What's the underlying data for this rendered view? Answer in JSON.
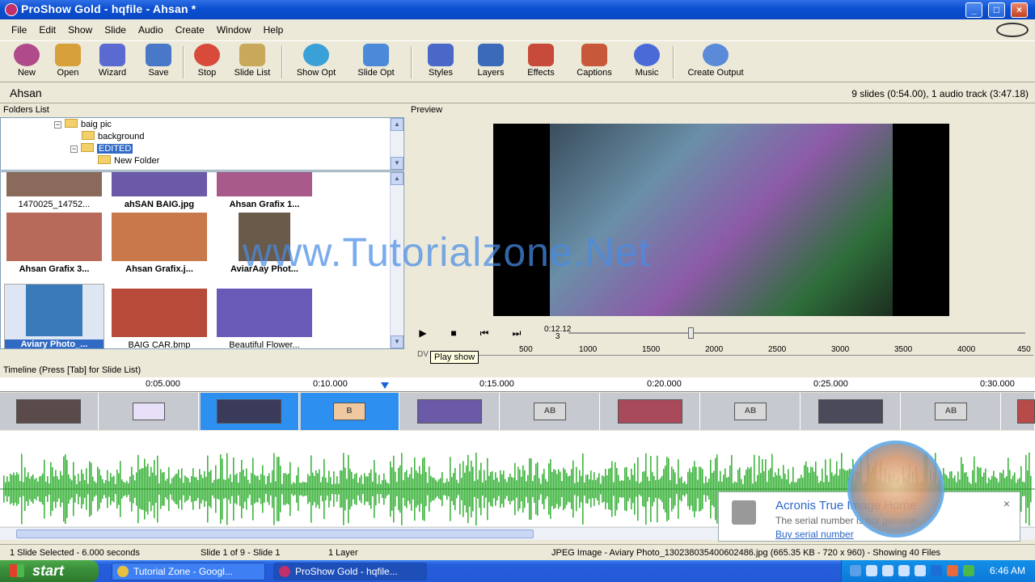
{
  "window": {
    "title": "ProShow Gold - hqfile - Ahsan *"
  },
  "menu": [
    "File",
    "Edit",
    "Show",
    "Slide",
    "Audio",
    "Create",
    "Window",
    "Help"
  ],
  "toolbar": [
    {
      "label": "New",
      "icon": "new-icon",
      "color": "#b04a8a"
    },
    {
      "label": "Open",
      "icon": "open-icon",
      "color": "#d8a03a"
    },
    {
      "label": "Wizard",
      "icon": "wizard-icon",
      "color": "#5a6ad0"
    },
    {
      "label": "Save",
      "icon": "save-icon",
      "color": "#4a78c8"
    },
    {
      "label": "Stop",
      "icon": "stop-icon",
      "color": "#d84a3a"
    },
    {
      "label": "Slide List",
      "icon": "slide-list-icon",
      "color": "#c8a85a"
    },
    {
      "label": "Show Opt",
      "icon": "show-options-icon",
      "color": "#3aa0d8"
    },
    {
      "label": "Slide Opt",
      "icon": "slide-options-icon",
      "color": "#4a8ad8"
    },
    {
      "label": "Styles",
      "icon": "styles-icon",
      "color": "#4a68c8"
    },
    {
      "label": "Layers",
      "icon": "layers-icon",
      "color": "#3a6ab8"
    },
    {
      "label": "Effects",
      "icon": "effects-icon",
      "color": "#c84a3a"
    },
    {
      "label": "Captions",
      "icon": "captions-icon",
      "color": "#c8583a"
    },
    {
      "label": "Music",
      "icon": "music-icon",
      "color": "#4a6ad8"
    },
    {
      "label": "Create Output",
      "icon": "create-output-icon",
      "color": "#5a8ad8"
    }
  ],
  "show": {
    "name": "Ahsan",
    "info": "9 slides (0:54.00), 1 audio track (3:47.18)"
  },
  "folders": {
    "header": "Folders List",
    "items": [
      {
        "label": "baig pic",
        "expander": "−"
      },
      {
        "label": "background",
        "expander": ""
      },
      {
        "label": "EDITED",
        "expander": "−"
      },
      {
        "label": "New Folder",
        "expander": ""
      }
    ]
  },
  "files": [
    {
      "name": "1470025_14752...",
      "color": "#8a6a5a"
    },
    {
      "name": "ahSAN BAIG.jpg",
      "color": "#6a5aa8"
    },
    {
      "name": "Ahsan Grafix 1...",
      "color": "#a85a8a"
    },
    {
      "name": "Ahsan Grafix 3...",
      "color": "#b86a5a"
    },
    {
      "name": "Ahsan Grafix.j...",
      "color": "#c8784a"
    },
    {
      "name": "AviarAay Phot...",
      "color": "#6a5a4a"
    },
    {
      "name": "Aviary Photo_...",
      "color": "#3a7ab8"
    },
    {
      "name": "BAIG CAR.bmp",
      "color": "#b84a3a"
    },
    {
      "name": "Beautiful Flower...",
      "color": "#6a5ab8"
    }
  ],
  "preview": {
    "header": "Preview",
    "watermark": "www.Tutorialzone.Net",
    "timecode": "0:12.12",
    "frame": "3",
    "tooltip": "Play show",
    "ruler_label": "DV",
    "ruler_ticks": [
      "500",
      "1000",
      "1500",
      "2000",
      "2500",
      "3000",
      "3500",
      "4000",
      "450"
    ]
  },
  "timeline": {
    "header": "Timeline (Press [Tab] for Slide List)",
    "ticks": [
      "0:05.000",
      "0:10.000",
      "0:15.000",
      "0:20.000",
      "0:25.000",
      "0:30.000"
    ],
    "transition_label": "AB",
    "transition_selected_label": "B"
  },
  "notification": {
    "title": "Acronis True Image Home",
    "message": "The serial number is not genuine.",
    "link": "Buy serial number",
    "close": "×"
  },
  "status": {
    "selected": "1 Slide Selected - 6.000 seconds",
    "slide": "Slide 1 of 9 - Slide 1",
    "layers": "1 Layer",
    "file": "JPEG Image - Aviary Photo_130238035400602486.jpg (665.35 KB - 720 x 960) - Showing 40 Files"
  },
  "taskbar": {
    "start": "start",
    "tasks": [
      "Tutorial Zone - Googl...",
      "ProShow Gold - hqfile..."
    ],
    "clock": "6:46 AM"
  }
}
